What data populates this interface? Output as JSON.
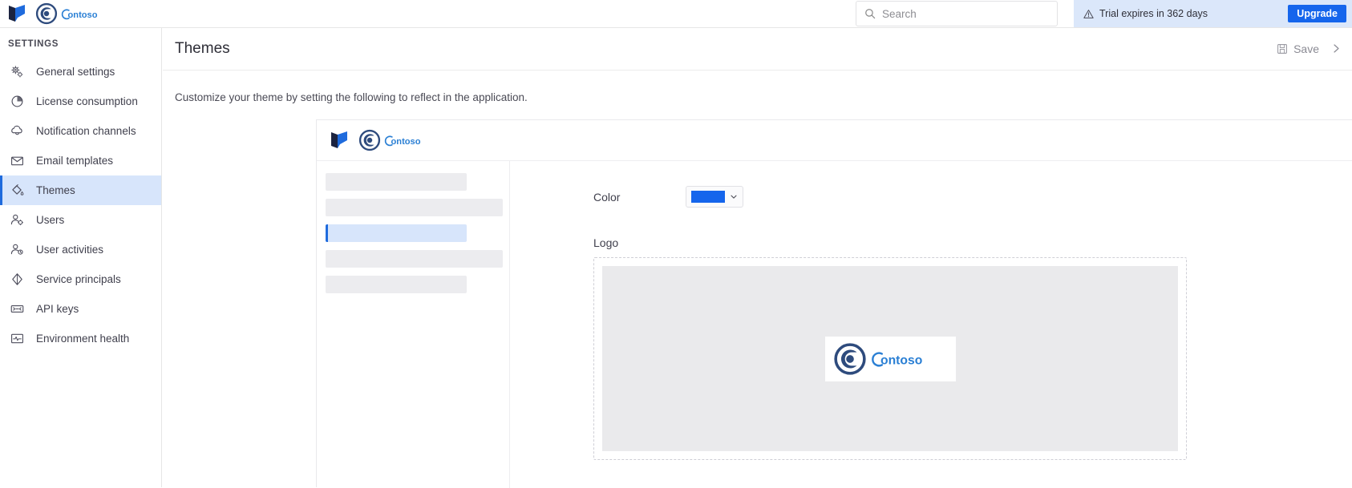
{
  "app": {
    "brand_name": "Contoso",
    "accent_color": "#1565ec",
    "active_nav_color": "#d7e5fb"
  },
  "topbar": {
    "search": {
      "placeholder": "Search",
      "value": "",
      "icon": "search-icon"
    },
    "trial": {
      "icon": "warning-triangle-icon",
      "text": "Trial expires in 362 days",
      "upgrade_label": "Upgrade",
      "background": "#dbe7fa",
      "upgrade_color": "#1565ec"
    }
  },
  "sidebar": {
    "heading": "SETTINGS",
    "items": [
      {
        "label": "General settings",
        "icon": "gears-icon",
        "active": false
      },
      {
        "label": "License consumption",
        "icon": "pie-chart-icon",
        "active": false
      },
      {
        "label": "Notification channels",
        "icon": "bell-cloud-icon",
        "active": false
      },
      {
        "label": "Email templates",
        "icon": "envelope-icon",
        "active": false
      },
      {
        "label": "Themes",
        "icon": "paint-bucket-icon",
        "active": true
      },
      {
        "label": "Users",
        "icon": "user-gear-icon",
        "active": false
      },
      {
        "label": "User activities",
        "icon": "user-clock-icon",
        "active": false
      },
      {
        "label": "Service principals",
        "icon": "diamond-icon",
        "active": false
      },
      {
        "label": "API keys",
        "icon": "key-card-icon",
        "active": false
      },
      {
        "label": "Environment health",
        "icon": "pulse-icon",
        "active": false
      }
    ]
  },
  "main": {
    "title": "Themes",
    "save_label": "Save",
    "save_icon": "floppy-save-icon",
    "collapse_icon": "chevron-right-icon",
    "description": "Customize your theme by setting the following to reflect in the application."
  },
  "preview": {
    "brand_name": "Contoso",
    "nav_skeletons": [
      {
        "width": "short",
        "active": false
      },
      {
        "width": "long",
        "active": false
      },
      {
        "width": "short",
        "active": true
      },
      {
        "width": "long",
        "active": false
      },
      {
        "width": "short",
        "active": false
      }
    ],
    "color_field": {
      "label": "Color",
      "value": "#1565ec",
      "chevron_icon": "chevron-down-icon"
    },
    "logo_field": {
      "label": "Logo",
      "logo_alt": "Contoso",
      "placeholder_background": "#eaeaec"
    }
  }
}
